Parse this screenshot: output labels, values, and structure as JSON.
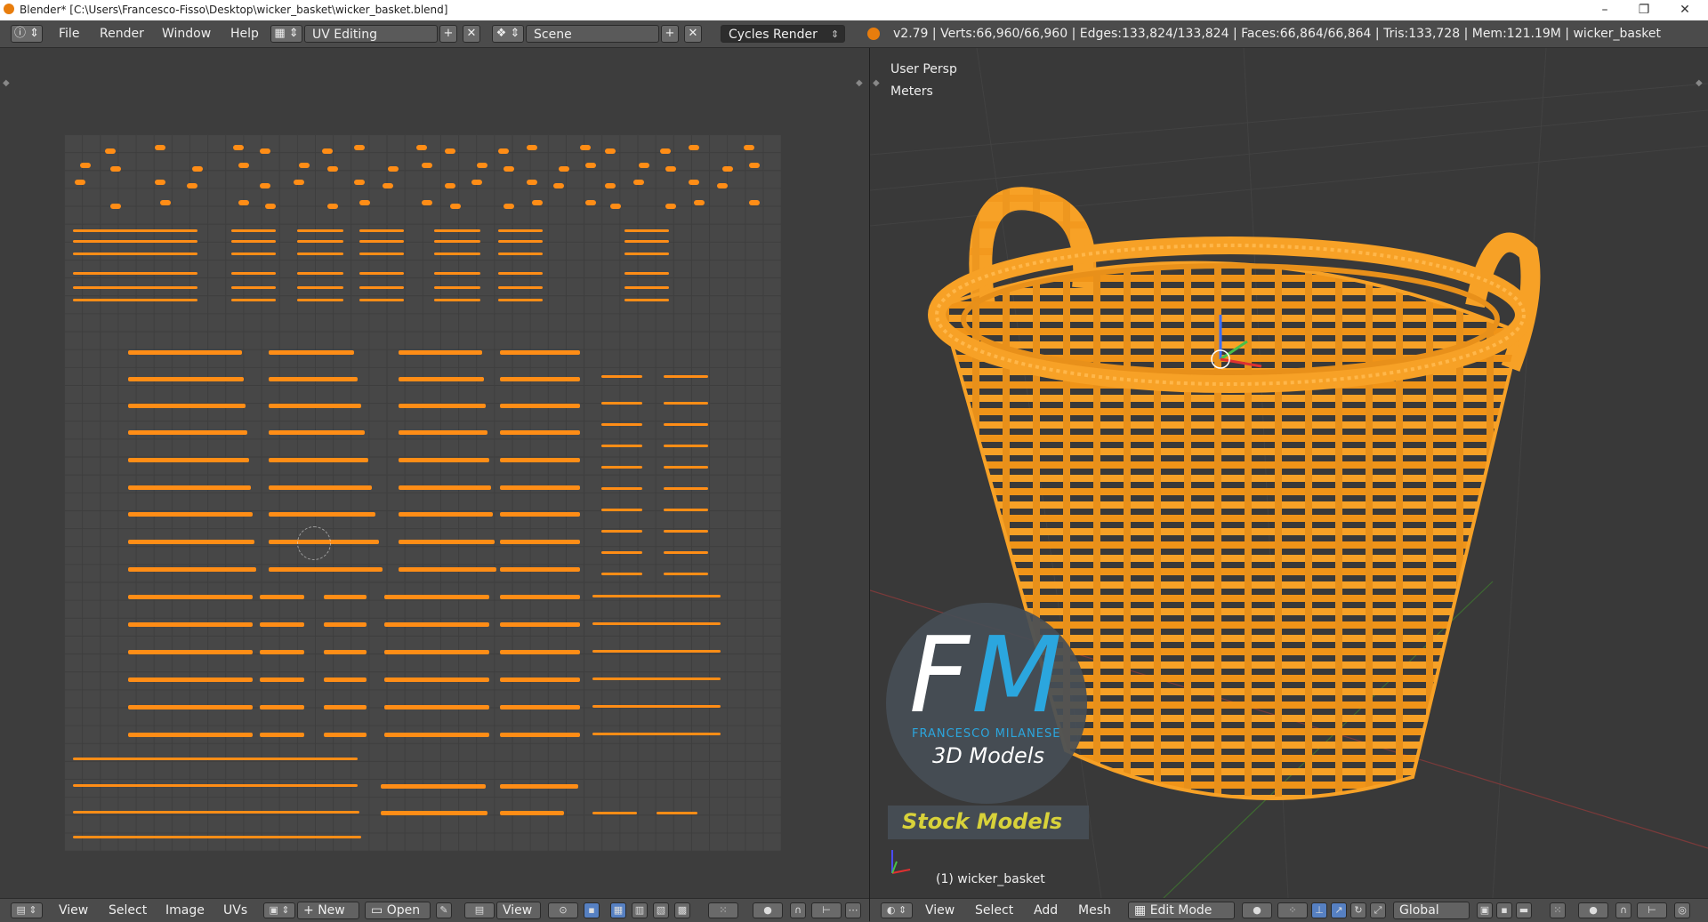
{
  "window": {
    "title": "Blender* [C:\\Users\\Francesco-Fisso\\Desktop\\wicker_basket\\wicker_basket.blend]",
    "minimize": "–",
    "maximize": "❐",
    "close": "✕"
  },
  "header": {
    "menus": [
      "File",
      "Render",
      "Window",
      "Help"
    ],
    "screen_layout": "UV Editing",
    "scene": "Scene",
    "render_engine": "Cycles Render",
    "stats": "v2.79 | Verts:66,960/66,960 | Edges:133,824/133,824 | Faces:66,864/66,864 | Tris:133,728 | Mem:121.19M | wicker_basket"
  },
  "viewport": {
    "view_name": "User Persp",
    "units": "Meters",
    "object_label": "(1) wicker_basket"
  },
  "watermark": {
    "logo_f": "F",
    "logo_m": "M",
    "name": "FRANCESCO MILANESE",
    "subtitle": "3D Models",
    "banner": "Stock Models"
  },
  "uv_footer": {
    "menus": [
      "View",
      "Select",
      "Image",
      "UVs"
    ],
    "new_label": "New",
    "open_label": "Open",
    "view_label": "View"
  },
  "vp_footer": {
    "menus": [
      "View",
      "Select",
      "Add",
      "Mesh"
    ],
    "mode": "Edit Mode",
    "orientation": "Global"
  },
  "colors": {
    "uv_islands": "#ff8d16",
    "mesh": "#f59a1e",
    "brand_blue": "#2ba6de",
    "stock_yellow": "#d8d23a"
  }
}
